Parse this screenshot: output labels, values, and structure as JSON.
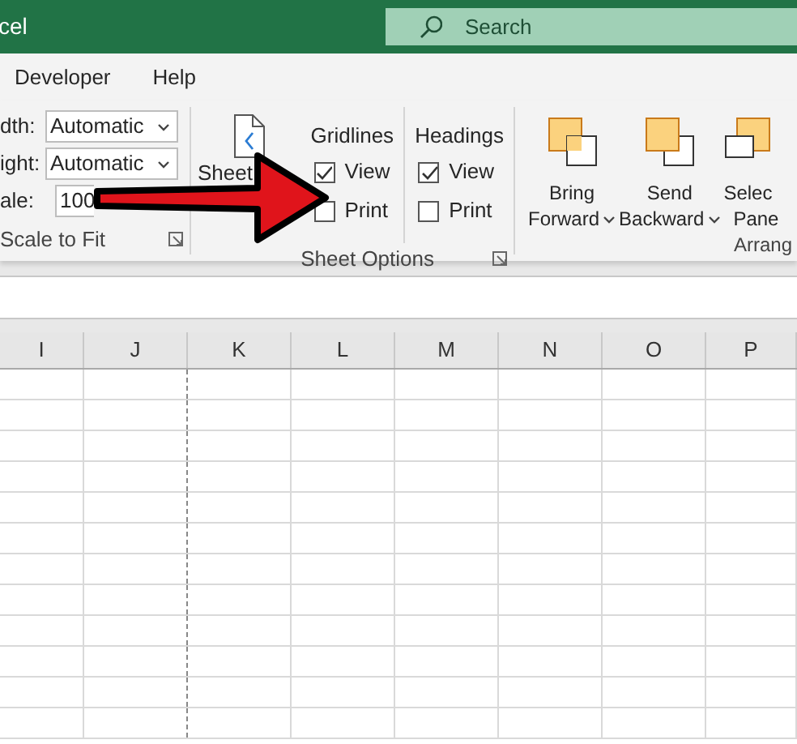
{
  "title": "cel",
  "search": {
    "placeholder": "Search"
  },
  "tabs": [
    {
      "label": "Developer",
      "selected": false
    },
    {
      "label": "Help",
      "selected": false
    }
  ],
  "scale_to_fit": {
    "fields": [
      {
        "label": "dth:",
        "value": "Automatic",
        "kind": "dropdown"
      },
      {
        "label": "ight:",
        "value": "Automatic",
        "kind": "dropdown"
      },
      {
        "label": "ale:",
        "value": "100",
        "kind": "spinner"
      }
    ],
    "group_label": "Scale to Fit"
  },
  "sheet_options": {
    "button": [
      "Sheet"
    ],
    "columns": [
      {
        "heading": "Gridlines",
        "options": [
          {
            "label": "View",
            "checked": true
          },
          {
            "label": "Print",
            "checked": false
          }
        ]
      },
      {
        "heading": "Headings",
        "options": [
          {
            "label": "View",
            "checked": true
          },
          {
            "label": "Print",
            "checked": false
          }
        ]
      }
    ],
    "group_label": "Sheet Options"
  },
  "arrange": {
    "buttons": [
      {
        "label": [
          "Bring",
          "Forward"
        ],
        "dropdown": true
      },
      {
        "label": [
          "Send",
          "Backward"
        ],
        "dropdown": true
      },
      {
        "label": [
          "Selec",
          "Pane"
        ],
        "dropdown": false
      }
    ],
    "group_label": "Arrang"
  },
  "columns": [
    "I",
    "J",
    "K",
    "L",
    "M",
    "N",
    "O",
    "P"
  ]
}
